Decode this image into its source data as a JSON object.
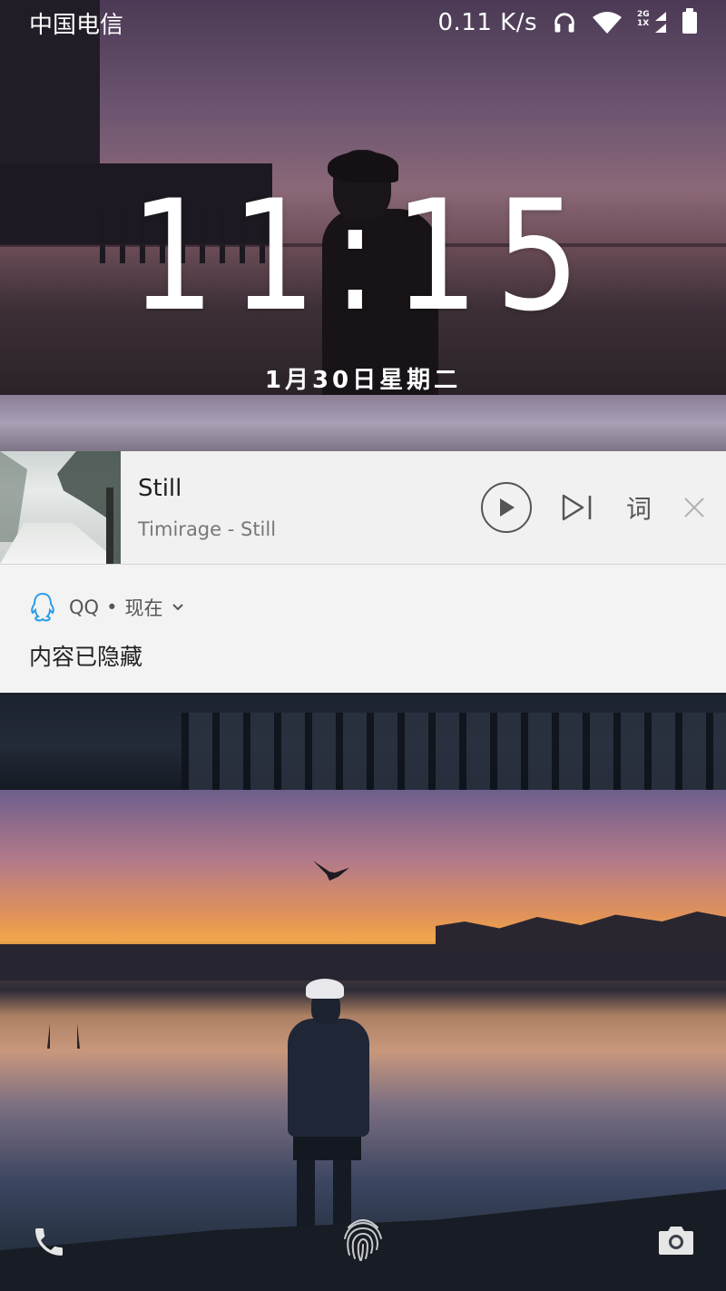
{
  "status_bar": {
    "carrier": "中国电信",
    "net_speed": "0.11 K/s",
    "sim_top": "2G",
    "sim_bottom": "1X",
    "icons": [
      "headphones-icon",
      "wifi-icon",
      "signal-icon",
      "battery-icon"
    ]
  },
  "lockscreen": {
    "time": "11:15",
    "date": "1月30日星期二"
  },
  "music_notification": {
    "title": "Still",
    "subtitle": "Timirage - Still",
    "lyrics_label": "词",
    "controls": [
      "play-icon",
      "next-icon",
      "lyrics-icon",
      "close-icon"
    ]
  },
  "qq_notification": {
    "app": "QQ",
    "separator": "•",
    "time": "现在",
    "content": "内容已隐藏"
  },
  "shortcuts": [
    "phone-icon",
    "fingerprint-icon",
    "camera-icon"
  ],
  "colors": {
    "card_bg": "#f1f1f1",
    "qq_icon": "#2b9de8",
    "text_dark": "#1f1f1f",
    "text_muted": "#777777"
  }
}
